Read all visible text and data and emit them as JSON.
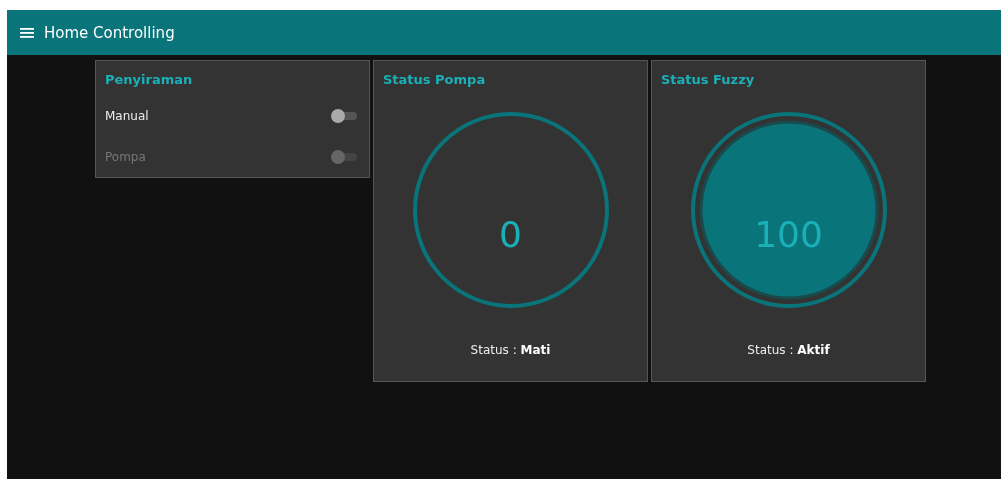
{
  "header": {
    "title": "Home Controlling"
  },
  "penyiraman": {
    "title": "Penyiraman",
    "switches": [
      {
        "label": "Manual",
        "checked": false,
        "disabled": false
      },
      {
        "label": "Pompa",
        "checked": false,
        "disabled": true
      }
    ]
  },
  "gauges": [
    {
      "title": "Status Pompa",
      "value": "0",
      "filled": false,
      "status": "Status : **Mati**"
    },
    {
      "title": "Status Fuzzy",
      "value": "100",
      "filled": true,
      "status": "Status : **Aktif**"
    }
  ]
}
